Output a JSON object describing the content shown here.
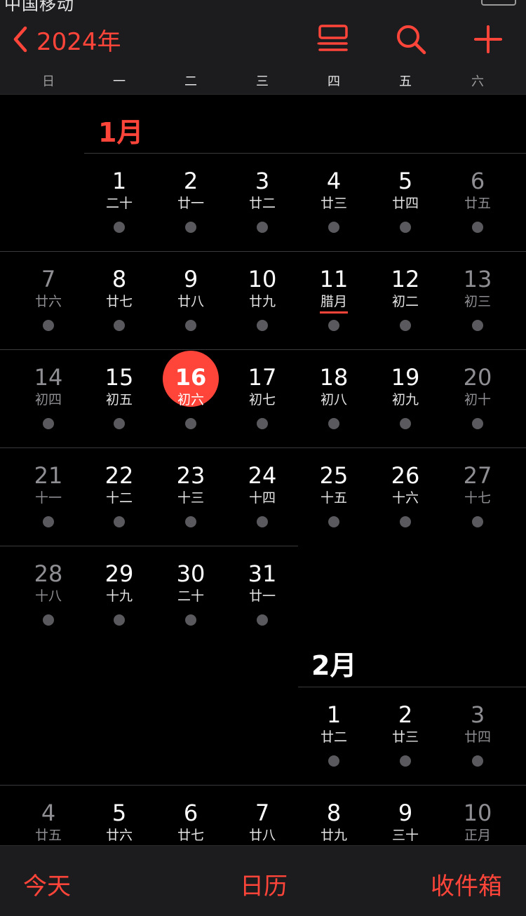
{
  "status_bar": {
    "carrier": "中国移动"
  },
  "header": {
    "back_icon": "chevron-left-icon",
    "year_label": "2024年",
    "icons": [
      "list-view-icon",
      "search-icon",
      "plus-icon"
    ]
  },
  "weekdays": [
    "日",
    "一",
    "二",
    "三",
    "四",
    "五",
    "六"
  ],
  "colors": {
    "accent": "#ff453a",
    "background": "#000000",
    "dim_text": "#8e8e93",
    "dot": "#5a5a5e"
  },
  "january": {
    "title": "1月",
    "days": [
      {
        "num": "1",
        "lunar": "二十"
      },
      {
        "num": "2",
        "lunar": "廿一"
      },
      {
        "num": "3",
        "lunar": "廿二"
      },
      {
        "num": "4",
        "lunar": "廿三"
      },
      {
        "num": "5",
        "lunar": "廿四"
      },
      {
        "num": "6",
        "lunar": "廿五"
      },
      {
        "num": "7",
        "lunar": "廿六"
      },
      {
        "num": "8",
        "lunar": "廿七"
      },
      {
        "num": "9",
        "lunar": "廿八"
      },
      {
        "num": "10",
        "lunar": "廿九"
      },
      {
        "num": "11",
        "lunar": "腊月"
      },
      {
        "num": "12",
        "lunar": "初二"
      },
      {
        "num": "13",
        "lunar": "初三"
      },
      {
        "num": "14",
        "lunar": "初四"
      },
      {
        "num": "15",
        "lunar": "初五"
      },
      {
        "num": "16",
        "lunar": "初六"
      },
      {
        "num": "17",
        "lunar": "初七"
      },
      {
        "num": "18",
        "lunar": "初八"
      },
      {
        "num": "19",
        "lunar": "初九"
      },
      {
        "num": "20",
        "lunar": "初十"
      },
      {
        "num": "21",
        "lunar": "十一"
      },
      {
        "num": "22",
        "lunar": "十二"
      },
      {
        "num": "23",
        "lunar": "十三"
      },
      {
        "num": "24",
        "lunar": "十四"
      },
      {
        "num": "25",
        "lunar": "十五"
      },
      {
        "num": "26",
        "lunar": "十六"
      },
      {
        "num": "27",
        "lunar": "十七"
      },
      {
        "num": "28",
        "lunar": "十八"
      },
      {
        "num": "29",
        "lunar": "十九"
      },
      {
        "num": "30",
        "lunar": "二十"
      },
      {
        "num": "31",
        "lunar": "廿一"
      }
    ]
  },
  "february": {
    "title": "2月",
    "days": [
      {
        "num": "1",
        "lunar": "廿二"
      },
      {
        "num": "2",
        "lunar": "廿三"
      },
      {
        "num": "3",
        "lunar": "廿四"
      },
      {
        "num": "4",
        "lunar": "廿五"
      },
      {
        "num": "5",
        "lunar": "廿六"
      },
      {
        "num": "6",
        "lunar": "廿七"
      },
      {
        "num": "7",
        "lunar": "廿八"
      },
      {
        "num": "8",
        "lunar": "廿九"
      },
      {
        "num": "9",
        "lunar": "三十"
      },
      {
        "num": "10",
        "lunar": "正月"
      }
    ]
  },
  "tabbar": {
    "today": "今天",
    "calendars": "日历",
    "inbox": "收件箱"
  }
}
